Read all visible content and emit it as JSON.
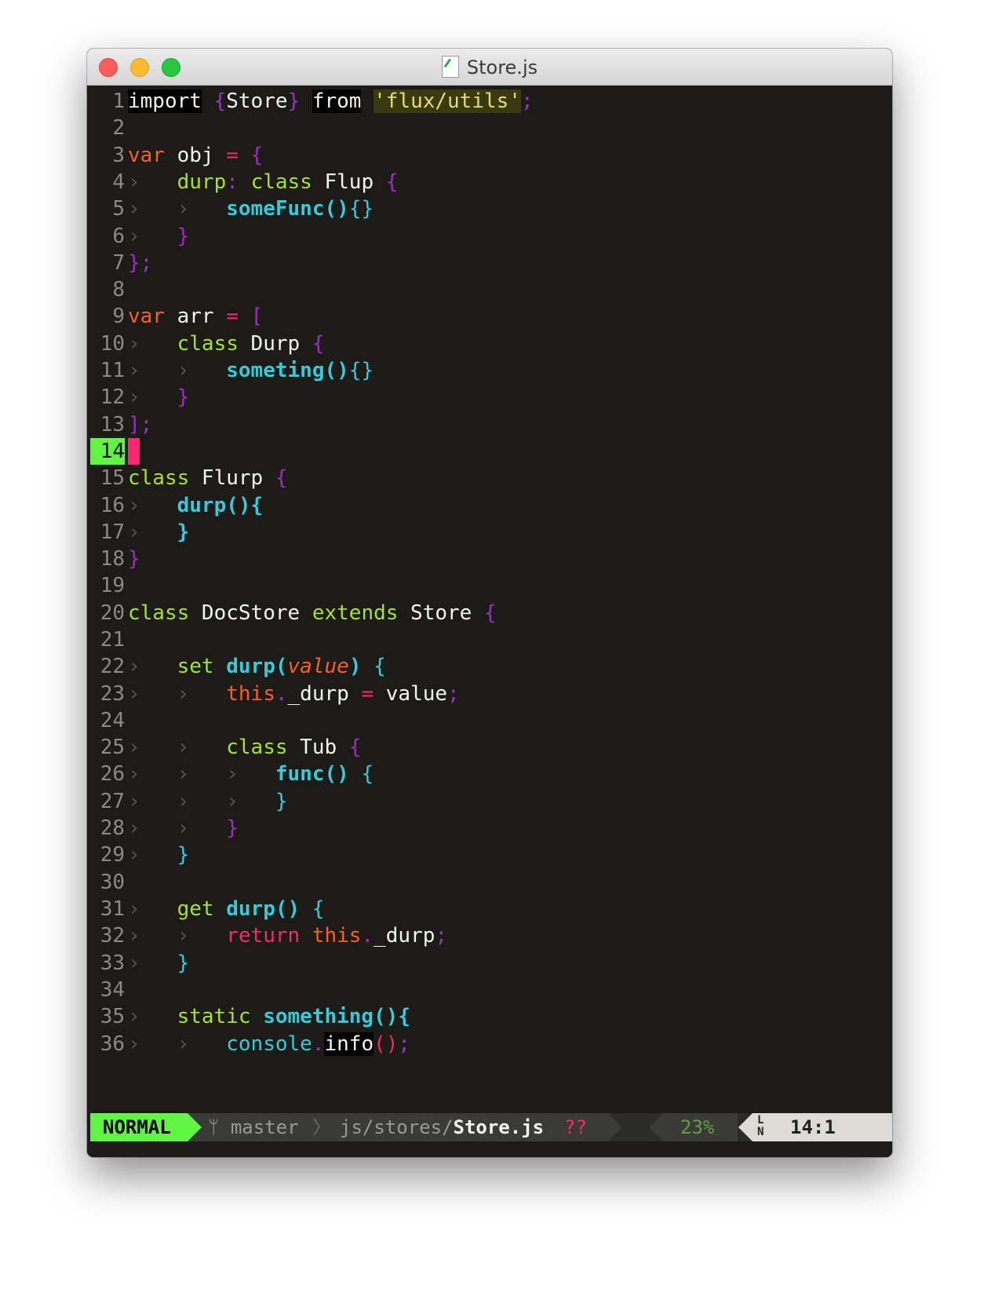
{
  "window": {
    "title": "Store.js"
  },
  "colors": {
    "background": "#1c1b17",
    "keyword": "#f92672",
    "keyword_orange": "#fd5e23",
    "green": "#a6e22e",
    "cyan": "#38cad9",
    "purple": "#9a2fc0",
    "string": "#e6db74",
    "mode_bg": "#5ff542"
  },
  "editor": {
    "current_line": "14",
    "lines": [
      {
        "n": "1",
        "segs": [
          {
            "t": "import",
            "c": "#f5f5f0",
            "bg": "#000000"
          },
          {
            "t": " "
          },
          {
            "t": "{",
            "c": "#9a2fc0"
          },
          {
            "t": "Store",
            "c": "#f5f5f0"
          },
          {
            "t": "}",
            "c": "#9a2fc0"
          },
          {
            "t": " "
          },
          {
            "t": "from",
            "c": "#f5f5f0",
            "bg": "#000000"
          },
          {
            "t": " "
          },
          {
            "t": "'flux/utils'",
            "c": "#e6db74",
            "bg": "#3a3a10"
          },
          {
            "t": ";",
            "c": "#9a2fc0"
          }
        ]
      },
      {
        "n": "2",
        "segs": []
      },
      {
        "n": "3",
        "segs": [
          {
            "t": "var",
            "c": "#fd5e23"
          },
          {
            "t": " obj ",
            "c": "#f5f5f0"
          },
          {
            "t": "=",
            "c": "#f92672"
          },
          {
            "t": " "
          },
          {
            "t": "{",
            "c": "#9a2fc0"
          }
        ]
      },
      {
        "n": "4",
        "segs": [
          {
            "t": "› ",
            "c": "#55554f"
          },
          {
            "t": "  "
          },
          {
            "t": "durp",
            "c": "#a6e22e"
          },
          {
            "t": ":",
            "c": "#9a2fc0"
          },
          {
            "t": " "
          },
          {
            "t": "class",
            "c": "#a6e22e"
          },
          {
            "t": " Flup ",
            "c": "#f5f5f0"
          },
          {
            "t": "{",
            "c": "#9a2fc0"
          }
        ]
      },
      {
        "n": "5",
        "segs": [
          {
            "t": "› ",
            "c": "#55554f"
          },
          {
            "t": "  "
          },
          {
            "t": "› ",
            "c": "#55554f"
          },
          {
            "t": "  "
          },
          {
            "t": "someFunc",
            "c": "#38cad9",
            "b": true
          },
          {
            "t": "()",
            "c": "#38cad9",
            "b": true
          },
          {
            "t": "{}",
            "c": "#38cad9"
          }
        ]
      },
      {
        "n": "6",
        "segs": [
          {
            "t": "› ",
            "c": "#55554f"
          },
          {
            "t": "  "
          },
          {
            "t": "}",
            "c": "#9a2fc0"
          }
        ]
      },
      {
        "n": "7",
        "segs": [
          {
            "t": "};",
            "c": "#9a2fc0"
          }
        ]
      },
      {
        "n": "8",
        "segs": []
      },
      {
        "n": "9",
        "segs": [
          {
            "t": "var",
            "c": "#fd5e23"
          },
          {
            "t": " arr ",
            "c": "#f5f5f0"
          },
          {
            "t": "=",
            "c": "#f92672"
          },
          {
            "t": " "
          },
          {
            "t": "[",
            "c": "#9a2fc0"
          }
        ]
      },
      {
        "n": "10",
        "segs": [
          {
            "t": "› ",
            "c": "#55554f"
          },
          {
            "t": "  "
          },
          {
            "t": "class",
            "c": "#a6e22e"
          },
          {
            "t": " Durp ",
            "c": "#f5f5f0"
          },
          {
            "t": "{",
            "c": "#9a2fc0"
          }
        ]
      },
      {
        "n": "11",
        "segs": [
          {
            "t": "› ",
            "c": "#55554f"
          },
          {
            "t": "  "
          },
          {
            "t": "› ",
            "c": "#55554f"
          },
          {
            "t": "  "
          },
          {
            "t": "someting",
            "c": "#38cad9",
            "b": true
          },
          {
            "t": "()",
            "c": "#38cad9",
            "b": true
          },
          {
            "t": "{}",
            "c": "#38cad9"
          }
        ]
      },
      {
        "n": "12",
        "segs": [
          {
            "t": "› ",
            "c": "#55554f"
          },
          {
            "t": "  "
          },
          {
            "t": "}",
            "c": "#9a2fc0"
          }
        ]
      },
      {
        "n": "13",
        "segs": [
          {
            "t": "];",
            "c": "#9a2fc0"
          }
        ]
      },
      {
        "n": "14",
        "cursor": true,
        "segs": []
      },
      {
        "n": "15",
        "segs": [
          {
            "t": "class",
            "c": "#a6e22e"
          },
          {
            "t": " Flurp ",
            "c": "#f5f5f0"
          },
          {
            "t": "{",
            "c": "#9a2fc0"
          }
        ]
      },
      {
        "n": "16",
        "segs": [
          {
            "t": "› ",
            "c": "#55554f"
          },
          {
            "t": "  "
          },
          {
            "t": "durp",
            "c": "#38cad9",
            "b": true
          },
          {
            "t": "(){",
            "c": "#38cad9",
            "b": true
          }
        ]
      },
      {
        "n": "17",
        "segs": [
          {
            "t": "› ",
            "c": "#55554f"
          },
          {
            "t": "  "
          },
          {
            "t": "}",
            "c": "#38cad9",
            "b": true
          }
        ]
      },
      {
        "n": "18",
        "segs": [
          {
            "t": "}",
            "c": "#9a2fc0"
          }
        ]
      },
      {
        "n": "19",
        "segs": []
      },
      {
        "n": "20",
        "segs": [
          {
            "t": "class",
            "c": "#a6e22e"
          },
          {
            "t": " DocStore ",
            "c": "#f5f5f0"
          },
          {
            "t": "extends",
            "c": "#a6e22e"
          },
          {
            "t": " Store ",
            "c": "#f5f5f0"
          },
          {
            "t": "{",
            "c": "#9a2fc0"
          }
        ]
      },
      {
        "n": "21",
        "segs": []
      },
      {
        "n": "22",
        "segs": [
          {
            "t": "› ",
            "c": "#55554f"
          },
          {
            "t": "  "
          },
          {
            "t": "set",
            "c": "#a6e22e"
          },
          {
            "t": " "
          },
          {
            "t": "durp",
            "c": "#38cad9",
            "b": true
          },
          {
            "t": "(",
            "c": "#38cad9",
            "b": true
          },
          {
            "t": "value",
            "c": "#fd5e23",
            "i": true
          },
          {
            "t": ")",
            "c": "#38cad9",
            "b": true
          },
          {
            "t": " "
          },
          {
            "t": "{",
            "c": "#38cad9"
          }
        ]
      },
      {
        "n": "23",
        "segs": [
          {
            "t": "› ",
            "c": "#55554f"
          },
          {
            "t": "  "
          },
          {
            "t": "› ",
            "c": "#55554f"
          },
          {
            "t": "  "
          },
          {
            "t": "this",
            "c": "#fd5e23"
          },
          {
            "t": ".",
            "c": "#9a2fc0"
          },
          {
            "t": "_durp ",
            "c": "#f5f5f0"
          },
          {
            "t": "=",
            "c": "#f92672"
          },
          {
            "t": " value",
            "c": "#f5f5f0"
          },
          {
            "t": ";",
            "c": "#9a2fc0"
          }
        ]
      },
      {
        "n": "24",
        "segs": []
      },
      {
        "n": "25",
        "segs": [
          {
            "t": "› ",
            "c": "#55554f"
          },
          {
            "t": "  "
          },
          {
            "t": "› ",
            "c": "#55554f"
          },
          {
            "t": "  "
          },
          {
            "t": "class",
            "c": "#a6e22e"
          },
          {
            "t": " Tub ",
            "c": "#f5f5f0"
          },
          {
            "t": "{",
            "c": "#9a2fc0"
          }
        ]
      },
      {
        "n": "26",
        "segs": [
          {
            "t": "› ",
            "c": "#55554f"
          },
          {
            "t": "  "
          },
          {
            "t": "› ",
            "c": "#55554f"
          },
          {
            "t": "  "
          },
          {
            "t": "› ",
            "c": "#55554f"
          },
          {
            "t": "  "
          },
          {
            "t": "func",
            "c": "#38cad9",
            "b": true
          },
          {
            "t": "()",
            "c": "#38cad9",
            "b": true
          },
          {
            "t": " "
          },
          {
            "t": "{",
            "c": "#38cad9"
          }
        ]
      },
      {
        "n": "27",
        "segs": [
          {
            "t": "› ",
            "c": "#55554f"
          },
          {
            "t": "  "
          },
          {
            "t": "› ",
            "c": "#55554f"
          },
          {
            "t": "  "
          },
          {
            "t": "› ",
            "c": "#55554f"
          },
          {
            "t": "  "
          },
          {
            "t": "}",
            "c": "#38cad9"
          }
        ]
      },
      {
        "n": "28",
        "segs": [
          {
            "t": "› ",
            "c": "#55554f"
          },
          {
            "t": "  "
          },
          {
            "t": "› ",
            "c": "#55554f"
          },
          {
            "t": "  "
          },
          {
            "t": "}",
            "c": "#9a2fc0"
          }
        ]
      },
      {
        "n": "29",
        "segs": [
          {
            "t": "› ",
            "c": "#55554f"
          },
          {
            "t": "  "
          },
          {
            "t": "}",
            "c": "#38cad9"
          }
        ]
      },
      {
        "n": "30",
        "segs": []
      },
      {
        "n": "31",
        "segs": [
          {
            "t": "› ",
            "c": "#55554f"
          },
          {
            "t": "  "
          },
          {
            "t": "get",
            "c": "#a6e22e"
          },
          {
            "t": " "
          },
          {
            "t": "durp",
            "c": "#38cad9",
            "b": true
          },
          {
            "t": "()",
            "c": "#38cad9",
            "b": true
          },
          {
            "t": " "
          },
          {
            "t": "{",
            "c": "#38cad9"
          }
        ]
      },
      {
        "n": "32",
        "segs": [
          {
            "t": "› ",
            "c": "#55554f"
          },
          {
            "t": "  "
          },
          {
            "t": "› ",
            "c": "#55554f"
          },
          {
            "t": "  "
          },
          {
            "t": "return",
            "c": "#f92672"
          },
          {
            "t": " "
          },
          {
            "t": "this",
            "c": "#fd5e23"
          },
          {
            "t": ".",
            "c": "#9a2fc0"
          },
          {
            "t": "_durp",
            "c": "#f5f5f0"
          },
          {
            "t": ";",
            "c": "#9a2fc0"
          }
        ]
      },
      {
        "n": "33",
        "segs": [
          {
            "t": "› ",
            "c": "#55554f"
          },
          {
            "t": "  "
          },
          {
            "t": "}",
            "c": "#38cad9"
          }
        ]
      },
      {
        "n": "34",
        "segs": []
      },
      {
        "n": "35",
        "segs": [
          {
            "t": "› ",
            "c": "#55554f"
          },
          {
            "t": "  "
          },
          {
            "t": "static",
            "c": "#a6e22e"
          },
          {
            "t": " "
          },
          {
            "t": "something",
            "c": "#38cad9",
            "b": true
          },
          {
            "t": "(){",
            "c": "#38cad9",
            "b": true
          }
        ]
      },
      {
        "n": "36",
        "segs": [
          {
            "t": "› ",
            "c": "#55554f"
          },
          {
            "t": "  "
          },
          {
            "t": "› ",
            "c": "#55554f"
          },
          {
            "t": "  "
          },
          {
            "t": "console",
            "c": "#38cad9"
          },
          {
            "t": ".",
            "c": "#9a2fc0"
          },
          {
            "t": "info",
            "c": "#f5f5f0",
            "bg": "#000000"
          },
          {
            "t": "()",
            "c": "#f92672"
          },
          {
            "t": ";",
            "c": "#9a2fc0"
          }
        ]
      }
    ]
  },
  "statusline": {
    "mode": "NORMAL",
    "branch_icon": "branch-icon",
    "branch": "master",
    "path_dir": "js/stores/",
    "path_file": "Store.js",
    "flags": "??",
    "percent": "23%",
    "ln_icon_top": "L",
    "ln_icon_bottom": "N",
    "position": "14:1"
  }
}
